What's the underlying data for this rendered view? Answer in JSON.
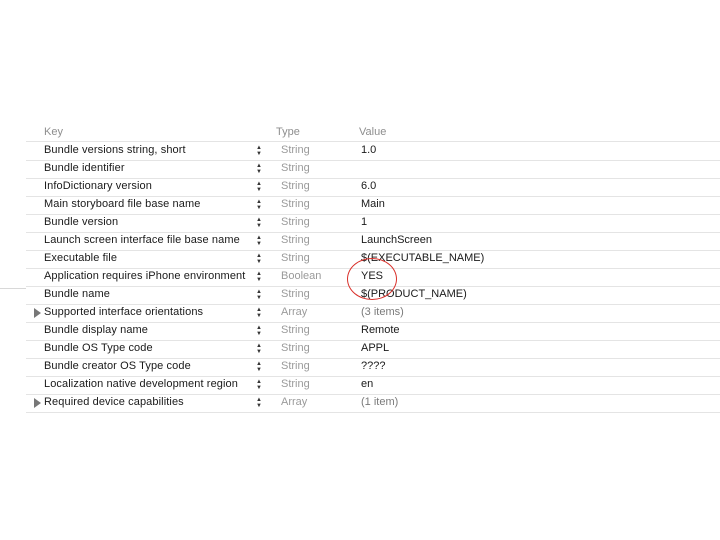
{
  "header": {
    "key": "Key",
    "type": "Type",
    "value": "Value"
  },
  "rows": [
    {
      "key": "Bundle versions string, short",
      "type": "String",
      "value": "1.0",
      "expandable": false
    },
    {
      "key": "Bundle identifier",
      "type": "String",
      "value": "",
      "expandable": false
    },
    {
      "key": "InfoDictionary version",
      "type": "String",
      "value": "6.0",
      "expandable": false
    },
    {
      "key": "Main storyboard file base name",
      "type": "String",
      "value": "Main",
      "expandable": false
    },
    {
      "key": "Bundle version",
      "type": "String",
      "value": "1",
      "expandable": false
    },
    {
      "key": "Launch screen interface file base name",
      "type": "String",
      "value": "LaunchScreen",
      "expandable": false
    },
    {
      "key": "Executable file",
      "type": "String",
      "value": "$(EXECUTABLE_NAME)",
      "expandable": false
    },
    {
      "key": "Application requires iPhone environment",
      "type": "Boolean",
      "value": "YES",
      "expandable": false,
      "highlighted": true
    },
    {
      "key": "Bundle name",
      "type": "String",
      "value": "$(PRODUCT_NAME)",
      "expandable": false
    },
    {
      "key": "Supported interface orientations",
      "type": "Array",
      "value": "(3 items)",
      "expandable": true
    },
    {
      "key": "Bundle display name",
      "type": "String",
      "value": "Remote",
      "expandable": false
    },
    {
      "key": "Bundle OS Type code",
      "type": "String",
      "value": "APPL",
      "expandable": false
    },
    {
      "key": "Bundle creator OS Type code",
      "type": "String",
      "value": "????",
      "expandable": false
    },
    {
      "key": "Localization native development region",
      "type": "String",
      "value": "en",
      "expandable": false
    },
    {
      "key": "Required device capabilities",
      "type": "Array",
      "value": "(1 item)",
      "expandable": true
    }
  ],
  "annotation": {
    "color": "#d9302a",
    "target_row": 7
  },
  "icons": {
    "disclosure": "disclosure-triangle-icon",
    "stepper": "up-down-stepper-icon"
  }
}
